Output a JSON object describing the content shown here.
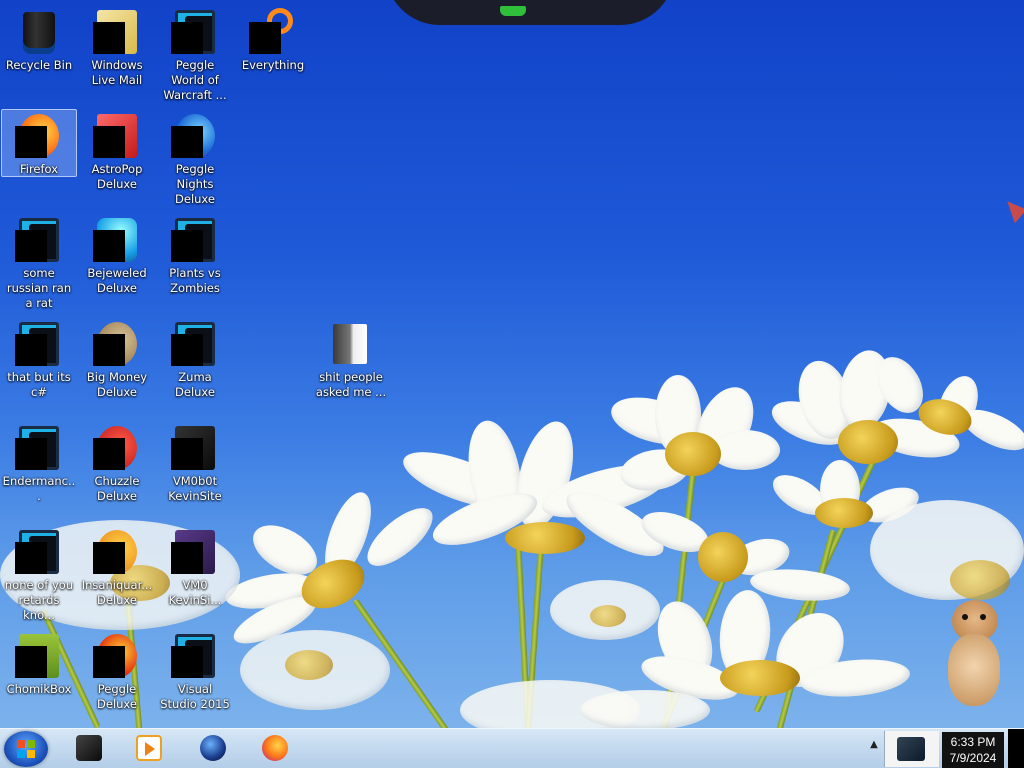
{
  "desktop": {
    "icons": [
      {
        "label": "Recycle Bin",
        "icon": "recycle-bin-icon"
      },
      {
        "label": "Windows Live Mail",
        "icon": "mail-icon"
      },
      {
        "label": "Peggle World of Warcraft ...",
        "icon": "peggle-wow-icon"
      },
      {
        "label": "Everything",
        "icon": "everything-search-icon"
      },
      {
        "label": "Firefox",
        "icon": "firefox-icon"
      },
      {
        "label": "AstroPop Deluxe",
        "icon": "astropop-icon"
      },
      {
        "label": "Peggle Nights Deluxe",
        "icon": "peggle-nights-icon"
      },
      {
        "label": "some russian ran a rat",
        "icon": "shortcut-icon"
      },
      {
        "label": "Bejeweled Deluxe",
        "icon": "bejeweled-icon"
      },
      {
        "label": "Plants vs Zombies",
        "icon": "plants-vs-zombies-icon"
      },
      {
        "label": "that but its c#",
        "icon": "shortcut-icon"
      },
      {
        "label": "Big Money Deluxe",
        "icon": "big-money-icon"
      },
      {
        "label": "Zuma Deluxe",
        "icon": "zuma-icon"
      },
      {
        "label": "shit people asked me ...",
        "icon": "folder-icon"
      },
      {
        "label": "Endermanc...",
        "icon": "shortcut-icon"
      },
      {
        "label": "Chuzzle Deluxe",
        "icon": "chuzzle-icon"
      },
      {
        "label": "VM0b0t KevinSite",
        "icon": "vm-shortcut-icon"
      },
      {
        "label": "none of you retards kno...",
        "icon": "shortcut-icon"
      },
      {
        "label": "Insaniquar... Deluxe",
        "icon": "insaniquarium-icon"
      },
      {
        "label": "VM0 KevinSi...",
        "icon": "vm-shortcut-icon"
      },
      {
        "label": "ChomikBox",
        "icon": "chomikbox-icon"
      },
      {
        "label": "Peggle Deluxe",
        "icon": "peggle-icon"
      },
      {
        "label": "Visual Studio 2015",
        "icon": "visual-studio-icon"
      }
    ]
  },
  "taskbar": {
    "start": "start-button",
    "pinned": [
      {
        "name": "explorer-icon"
      },
      {
        "name": "media-player-icon"
      },
      {
        "name": "globe-app-icon"
      },
      {
        "name": "firefox-icon"
      }
    ],
    "tray": {
      "overflow_label": "▲",
      "clock_time": "6:33 PM",
      "clock_date": "7/9/2024"
    }
  },
  "colors": {
    "sky": "#1f5ad8",
    "taskbar": "#c3d9ef",
    "selection": "#b4d2ff"
  }
}
